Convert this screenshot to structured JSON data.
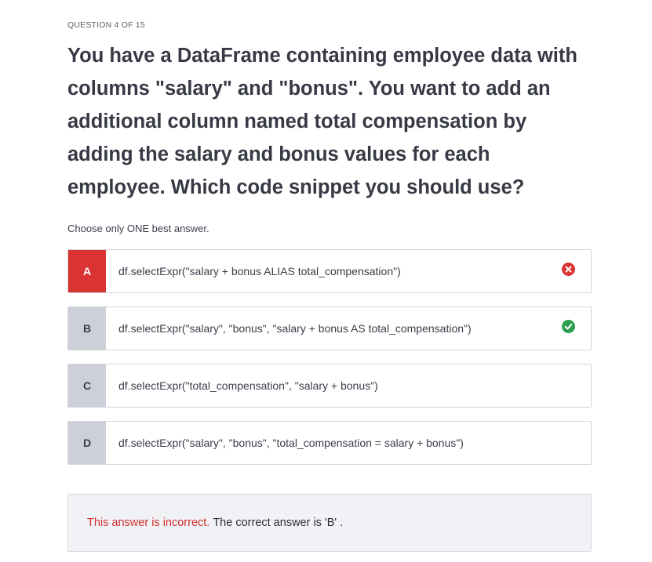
{
  "quiz": {
    "progress": "QUESTION 4 OF 15",
    "question": "You have a DataFrame containing employee data with columns \"salary\" and \"bonus\". You want to add an additional column named total compensation by adding the salary and bonus values for each employee. Which code snippet you should use?",
    "instruction": "Choose only ONE best answer.",
    "options": [
      {
        "letter": "A",
        "text": "df.selectExpr(\"salary + bonus ALIAS total_compensation\")",
        "status": "incorrect"
      },
      {
        "letter": "B",
        "text": "df.selectExpr(\"salary\", \"bonus\", \"salary + bonus AS total_compensation\")",
        "status": "correct"
      },
      {
        "letter": "C",
        "text": "df.selectExpr(\"total_compensation\", \"salary + bonus\")",
        "status": "none"
      },
      {
        "letter": "D",
        "text": "df.selectExpr(\"salary\", \"bonus\", \"total_compensation = salary + bonus\")",
        "status": "none"
      }
    ],
    "feedback": {
      "incorrect_label": "This answer is incorrect.",
      "correct_answer_text": "The correct answer is 'B' ."
    }
  },
  "colors": {
    "wrong": "#d93333",
    "right": "#2e9e4f",
    "letter_bg": "#cdd0d9",
    "feedback_bg": "#f1f2f5"
  },
  "icons": {
    "wrong": "x-circle-icon",
    "right": "check-circle-icon"
  }
}
